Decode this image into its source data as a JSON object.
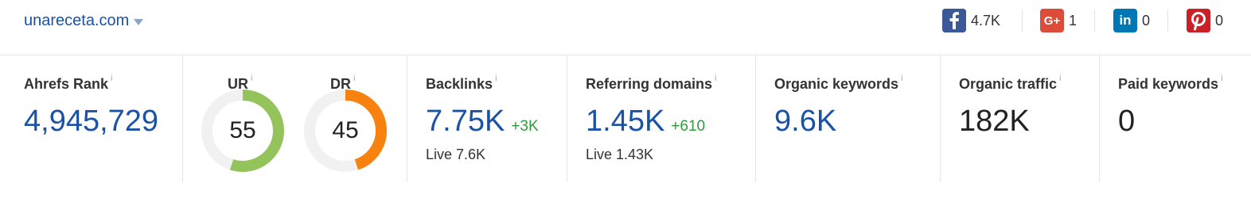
{
  "header": {
    "domain": "unareceta.com"
  },
  "social": [
    {
      "name": "facebook",
      "icon": "facebook-icon",
      "glyph": "f",
      "color": "#3b5998",
      "count": "4.7K"
    },
    {
      "name": "googleplus",
      "icon": "google-plus-icon",
      "glyph": "G+",
      "color": "#dd4b39",
      "count": "1"
    },
    {
      "name": "linkedin",
      "icon": "linkedin-icon",
      "glyph": "in",
      "color": "#0077b5",
      "count": "0"
    },
    {
      "name": "pinterest",
      "icon": "pinterest-icon",
      "glyph": "P",
      "color": "#cb2027",
      "count": "0"
    }
  ],
  "info_glyph": "i",
  "metrics": {
    "ahrefs_rank": {
      "label": "Ahrefs Rank",
      "value": "4,945,729"
    },
    "ur": {
      "label": "UR",
      "value": "55",
      "fraction": 0.55,
      "color": "#94c35c"
    },
    "dr": {
      "label": "DR",
      "value": "45",
      "fraction": 0.45,
      "color": "#f7820f"
    },
    "backlinks": {
      "label": "Backlinks",
      "value": "7.75K",
      "delta": "+3K",
      "sub": "Live 7.6K"
    },
    "referring_domains": {
      "label": "Referring domains",
      "value": "1.45K",
      "delta": "+610",
      "sub": "Live 1.43K"
    },
    "organic_keywords": {
      "label": "Organic keywords",
      "value": "9.6K"
    },
    "organic_traffic": {
      "label": "Organic traffic",
      "value": "182K"
    },
    "paid_keywords": {
      "label": "Paid keywords",
      "value": "0"
    }
  },
  "colors": {
    "link_blue": "#1a52a8",
    "delta_green": "#2e9b3d",
    "gauge_track": "#f1f1f1"
  }
}
